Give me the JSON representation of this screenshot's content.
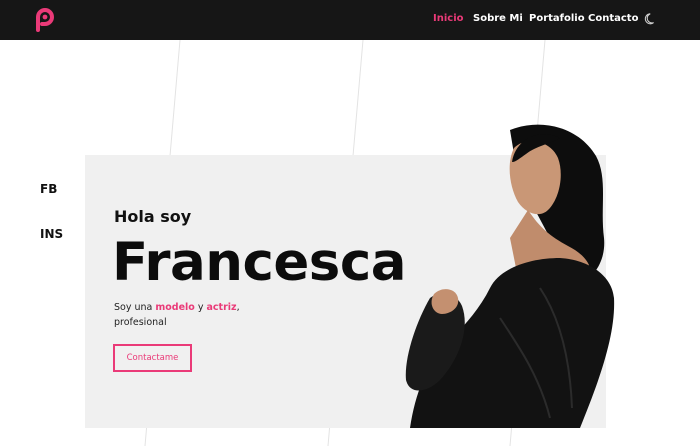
{
  "nav": {
    "items": [
      {
        "label": "Inicio",
        "active": true
      },
      {
        "label": "Sobre Mi",
        "active": false
      },
      {
        "label": "Portafolio",
        "active": false
      },
      {
        "label": "Contacto",
        "active": false
      }
    ],
    "theme_icon": "moon-icon",
    "logo_icon": "p-logo-icon"
  },
  "social": {
    "fb": "FB",
    "ins": "INS"
  },
  "hero": {
    "greeting": "Hola soy",
    "name": "Francesca",
    "desc_prefix": "Soy una ",
    "desc_hl1": "modelo",
    "desc_mid": " y ",
    "desc_hl2": "actriz",
    "desc_line2": ", profesional",
    "cta": "Contactame"
  },
  "colors": {
    "accent": "#ea3a78",
    "nav_bg": "#161616",
    "card_bg": "#f0f0f0"
  }
}
